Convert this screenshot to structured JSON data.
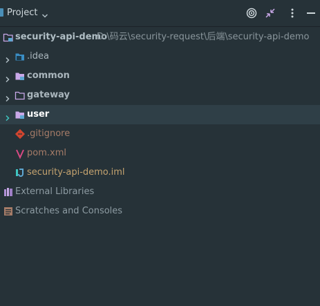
{
  "header": {
    "title": "Project",
    "icons": [
      "target-icon",
      "collapse-icon",
      "more-vertical-icon",
      "minimize-icon"
    ]
  },
  "tree": {
    "root": {
      "name": "security-api-demo",
      "path": "D:\\码云\\security-request\\后端\\security-api-demo"
    },
    "items": [
      {
        "label": ".idea",
        "icon": "idea-folder-icon"
      },
      {
        "label": "common",
        "icon": "module-folder-icon"
      },
      {
        "label": "gateway",
        "icon": "folder-icon"
      },
      {
        "label": "user",
        "icon": "module-folder-icon"
      },
      {
        "label": ".gitignore",
        "icon": "git-icon"
      },
      {
        "label": "pom.xml",
        "icon": "maven-icon"
      },
      {
        "label": "security-api-demo.iml",
        "icon": "iml-icon"
      }
    ],
    "external_libraries": "External Libraries",
    "scratches": "Scratches and Consoles"
  },
  "colors": {
    "background": "#263238",
    "selected_row": "#2f3f47",
    "folder": "#c9a8e8",
    "module_badge": "#5fa8d3",
    "accent_teal": "#3ec6c0"
  }
}
